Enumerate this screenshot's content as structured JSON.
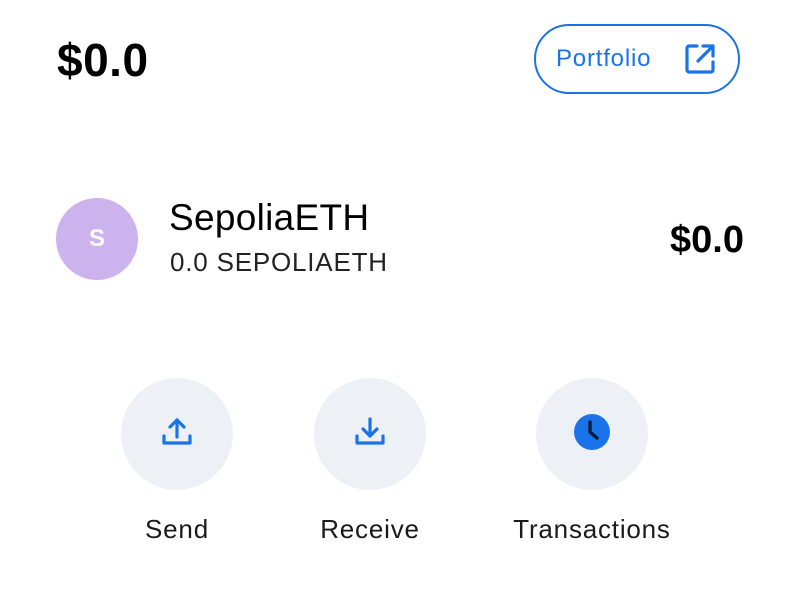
{
  "header": {
    "total_balance": "$0.0",
    "portfolio_label": "Portfolio",
    "portfolio_icon": "external-link-icon"
  },
  "asset": {
    "avatar_letter": "S",
    "avatar_color": "#cdb3ee",
    "name": "SepoliaETH",
    "amount": "0.0 SEPOLIAETH",
    "fiat_value": "$0.0"
  },
  "actions": [
    {
      "label": "Send",
      "icon": "upload-icon"
    },
    {
      "label": "Receive",
      "icon": "download-icon"
    },
    {
      "label": "Transactions",
      "icon": "clock-icon"
    }
  ],
  "colors": {
    "accent": "#1a73e8",
    "action_bg": "#edf1f6"
  }
}
